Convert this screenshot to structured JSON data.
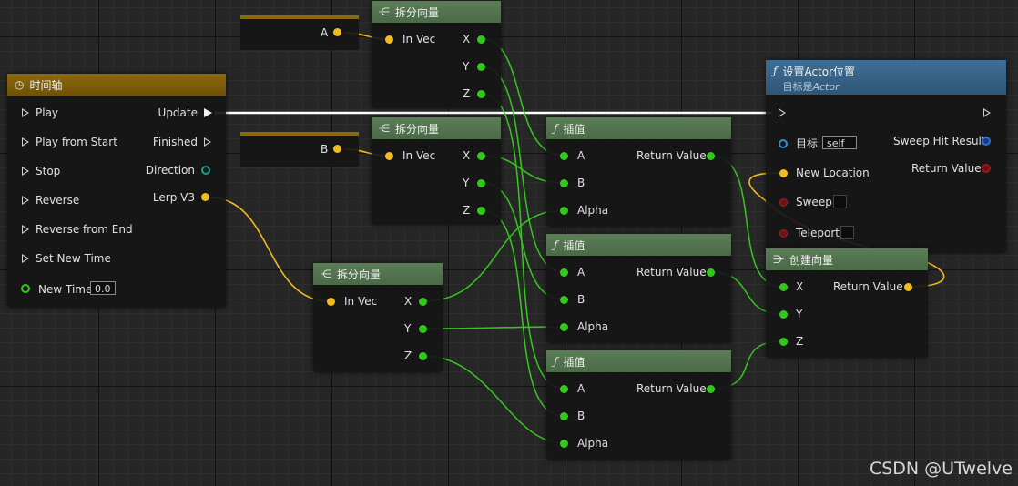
{
  "colors": {
    "grid_bg": "#262626",
    "vector_pin": "#f2bb1f",
    "float_pin": "#34c81e",
    "exec_wire": "#ffffff",
    "node_header_green": "#5a7d56",
    "node_header_gold": "#8a6a0c",
    "node_header_blue": "#3f6f96"
  },
  "timeline": {
    "title": "时间轴",
    "icon": "clock-icon",
    "inputs": [
      "Play",
      "Play from Start",
      "Stop",
      "Reverse",
      "Reverse from End",
      "Set New Time"
    ],
    "new_time_label": "New Time",
    "new_time_value": "0.0",
    "outputs": [
      "Update",
      "Finished",
      "Direction",
      "Lerp V3"
    ]
  },
  "reroute_a": {
    "label": "A"
  },
  "reroute_b": {
    "label": "B"
  },
  "break_nodes": [
    {
      "title": "拆分向量",
      "input": "In Vec",
      "outputs": [
        "X",
        "Y",
        "Z"
      ]
    },
    {
      "title": "拆分向量",
      "input": "In Vec",
      "outputs": [
        "X",
        "Y",
        "Z"
      ]
    },
    {
      "title": "拆分向量",
      "input": "In Vec",
      "outputs": [
        "X",
        "Y",
        "Z"
      ]
    }
  ],
  "lerp_nodes": [
    {
      "title": "插值",
      "inputs": [
        "A",
        "B",
        "Alpha"
      ],
      "output": "Return Value"
    },
    {
      "title": "插值",
      "inputs": [
        "A",
        "B",
        "Alpha"
      ],
      "output": "Return Value"
    },
    {
      "title": "插值",
      "inputs": [
        "A",
        "B",
        "Alpha"
      ],
      "output": "Return Value"
    }
  ],
  "set_location": {
    "title": "设置Actor位置",
    "subtitle_prefix": "目标是",
    "subtitle_target": "Actor",
    "target_label": "目标",
    "target_value": "self",
    "inputs": [
      "New Location",
      "Sweep",
      "Teleport"
    ],
    "outputs": [
      "Sweep Hit Result",
      "Return Value"
    ]
  },
  "make_vector": {
    "title": "创建向量",
    "inputs": [
      "X",
      "Y",
      "Z"
    ],
    "output": "Return Value"
  },
  "watermark": "CSDN @UTwelve"
}
